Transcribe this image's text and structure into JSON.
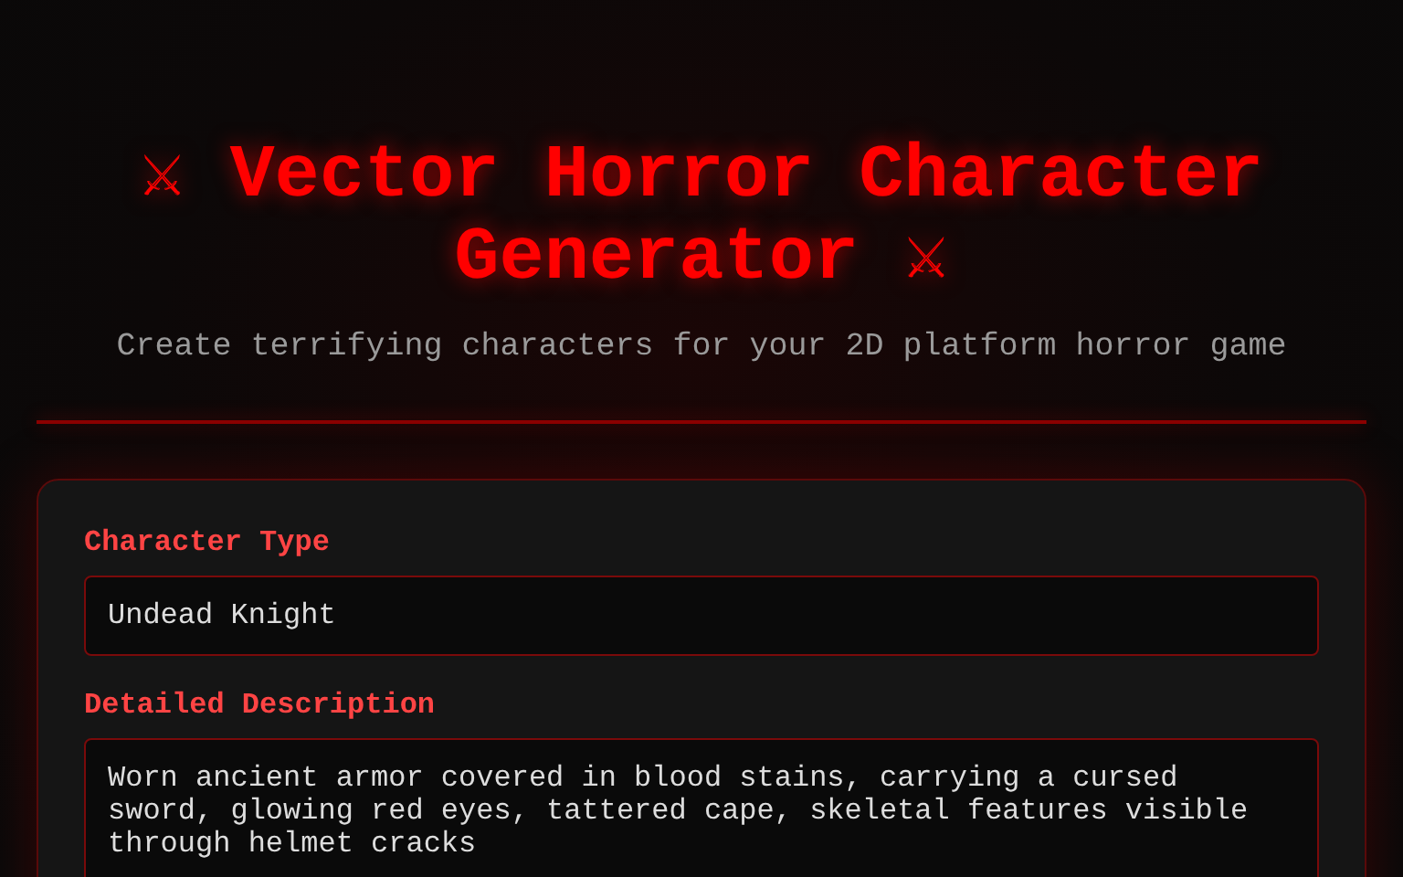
{
  "header": {
    "title": "⚔ Vector Horror Character Generator ⚔",
    "subtitle": "Create terrifying characters for your 2D platform horror game"
  },
  "form": {
    "fields": [
      {
        "kind": "input",
        "label": "Character Type",
        "value": "Undead Knight"
      },
      {
        "kind": "textarea",
        "label": "Detailed Description",
        "value": "Worn ancient armor covered in blood stains, carrying a cursed sword, glowing red eyes, tattered cape, skeletal features visible through helmet cracks"
      }
    ]
  }
}
